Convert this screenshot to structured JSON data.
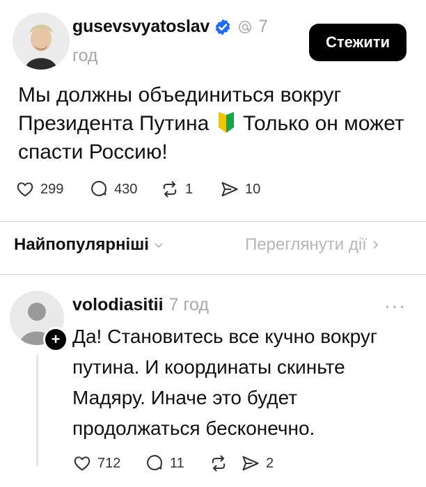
{
  "post": {
    "username": "gusevsvyatoslav",
    "time_num": "7",
    "time_unit": "год",
    "follow_label": "Стежити",
    "text_part1": "Мы должны объединиться вокруг Президента  Путина",
    "text_part2": "Только он может спасти Россию!",
    "stats": {
      "likes": "299",
      "comments": "430",
      "reposts": "1",
      "shares": "10"
    }
  },
  "sort": {
    "label": "Найпопулярніші",
    "activity_label": "Переглянути дії"
  },
  "comment": {
    "username": "volodiasitii",
    "time": "7 год",
    "more": "···",
    "text": "Да! Становитесь все кучно вокруг путина. И координаты скиньте Мадяру. Иначе это будет продолжаться бесконечно.",
    "stats": {
      "likes": "712",
      "comments": "11",
      "shares": "2"
    }
  },
  "colors": {
    "verified": "#1f6bff",
    "muted": "#a7a7a7",
    "button": "#000000"
  },
  "icons": [
    "verified-icon",
    "threads-icon",
    "heart-icon",
    "comment-icon",
    "repost-icon",
    "share-icon",
    "chevron-down-icon",
    "chevron-right-icon",
    "plus-icon",
    "more-icon"
  ]
}
